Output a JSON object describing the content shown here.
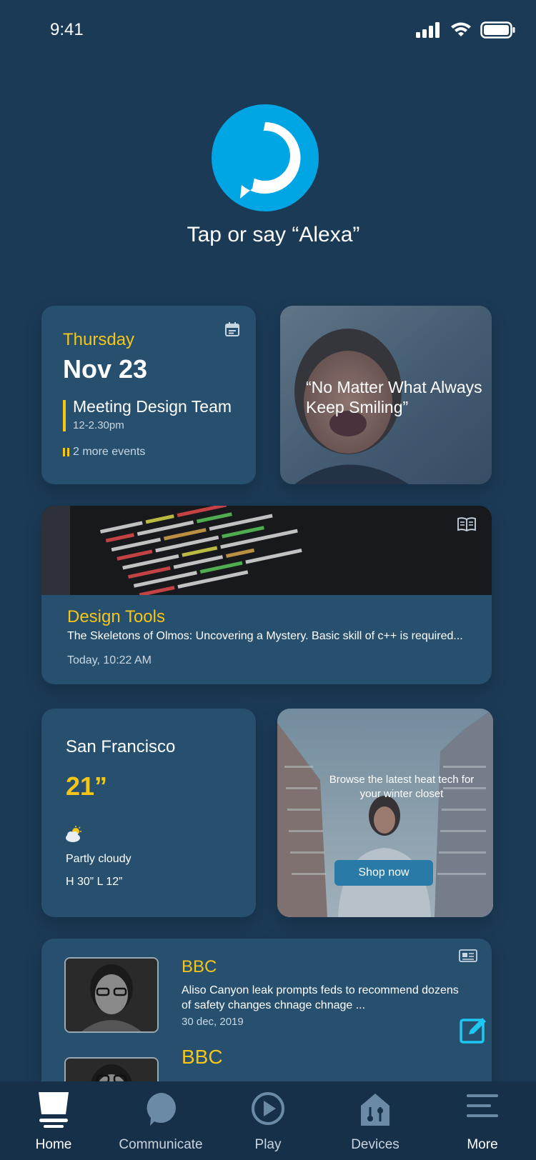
{
  "status_bar": {
    "time": "9:41"
  },
  "alexa": {
    "prompt": "Tap or say “Alexa”"
  },
  "calendar": {
    "day": "Thursday",
    "date": "Nov 23",
    "event_title": "Meeting Design Team",
    "event_time": "12-2.30pm",
    "more_events": "2 more events"
  },
  "quote": {
    "text": "“No Matter What Always Keep Smiling”"
  },
  "article": {
    "category": "Design Tools",
    "description": "The Skeletons of Olmos: Uncovering a Mystery. Basic skill of c++ is required...",
    "time": "Today, 10:22 AM"
  },
  "weather": {
    "city": "San Francisco",
    "temperature": "21”",
    "condition": "Partly cloudy",
    "high_low": "H 30” L 12”",
    "icon": "partly-cloudy-icon"
  },
  "shop": {
    "text": "Browse the latest heat tech for your winter closet",
    "button_label": "Shop now"
  },
  "news": {
    "items": [
      {
        "source": "BBC",
        "headline": "Aliso Canyon leak prompts feds to recommend dozens of safety changes chnage chnage ...",
        "date": "30 dec, 2019"
      },
      {
        "source": "BBC"
      }
    ]
  },
  "nav": {
    "items": [
      {
        "label": "Home",
        "icon": "home-icon"
      },
      {
        "label": "Communicate",
        "icon": "chat-icon"
      },
      {
        "label": "Play",
        "icon": "play-icon"
      },
      {
        "label": "Devices",
        "icon": "devices-icon"
      },
      {
        "label": "More",
        "icon": "menu-icon"
      }
    ]
  },
  "colors": {
    "background": "#1b3a56",
    "card": "#27506f",
    "accent_yellow": "#f5c518",
    "alexa_blue": "#00a6e4",
    "nav_bg": "#17304a"
  }
}
